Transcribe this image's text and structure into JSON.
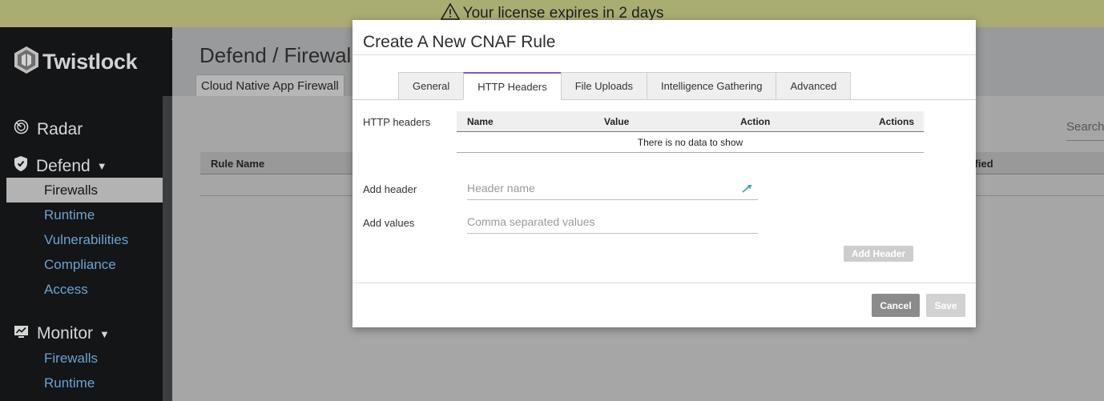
{
  "banner": {
    "text": "Your license expires in 2 days",
    "icon": "warning-icon"
  },
  "brand": {
    "name": "Twistlock",
    "icon": "twistlock-logo-icon"
  },
  "sidebar": {
    "collapse_icon": "triangle-left-icon",
    "sections": [
      {
        "label": "Radar",
        "icon": "radar-icon"
      },
      {
        "label": "Defend",
        "icon": "shield-icon",
        "caret": "▼"
      },
      {
        "label": "Monitor",
        "icon": "monitor-icon",
        "caret": "▼"
      }
    ],
    "defend_items": [
      "Firewalls",
      "Runtime",
      "Vulnerabilities",
      "Compliance",
      "Access"
    ],
    "monitor_items": [
      "Firewalls",
      "Runtime"
    ],
    "active_item": "Firewalls"
  },
  "main": {
    "title": "Defend / Firewalls",
    "tab": "Cloud Native App Firewall",
    "search_placeholder": "Search",
    "table_headers": {
      "rule_name": "Rule Name",
      "modified": "dified"
    }
  },
  "modal": {
    "title": "Create A New CNAF Rule",
    "tabs": [
      "General",
      "HTTP Headers",
      "File Uploads",
      "Intelligence Gathering",
      "Advanced"
    ],
    "active_tab": "HTTP Headers",
    "http_headers_label": "HTTP headers",
    "table": {
      "columns": [
        "Name",
        "Value",
        "Action",
        "Actions"
      ],
      "empty_text": "There is no data to show"
    },
    "add_header_label": "Add header",
    "header_name_placeholder": "Header name",
    "add_values_label": "Add values",
    "values_placeholder": "Comma separated values",
    "add_header_button": "Add Header",
    "cancel_button": "Cancel",
    "save_button": "Save"
  },
  "colors": {
    "banner_bg": "#a9ad72",
    "sidebar_bg": "#141516",
    "link_blue": "#6aa3d3",
    "active_tab_accent": "#7b57c7"
  }
}
